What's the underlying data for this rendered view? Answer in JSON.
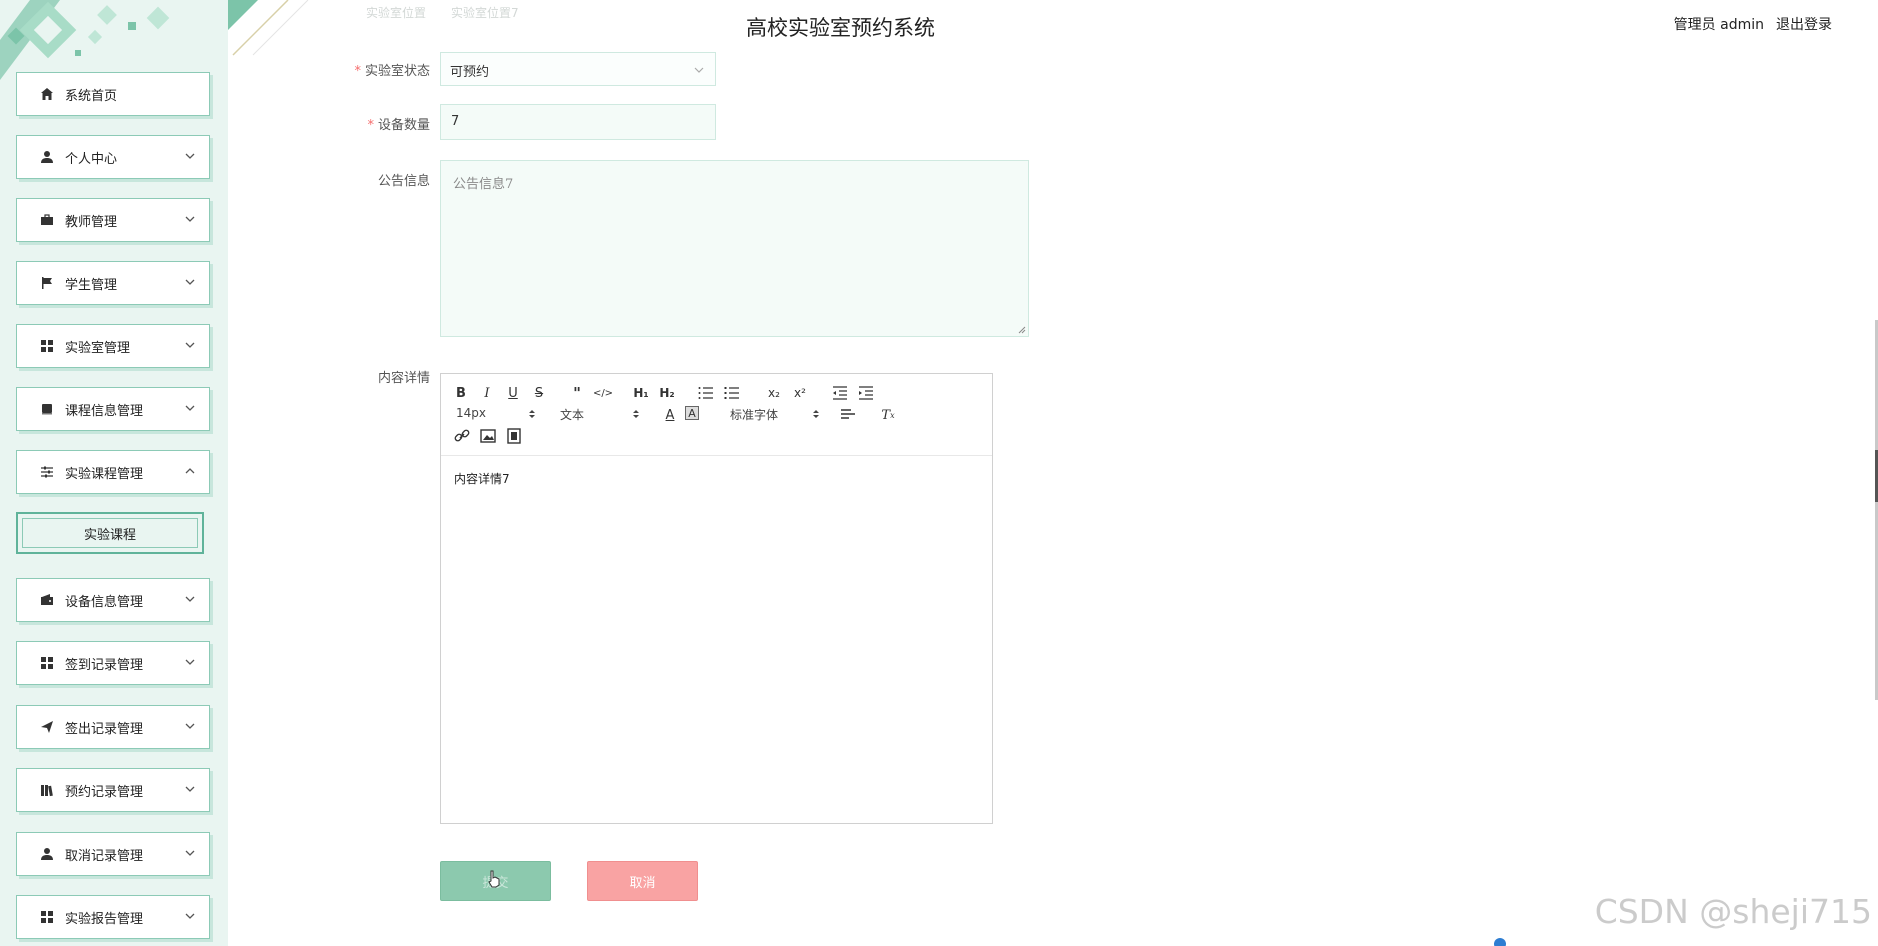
{
  "header": {
    "title": "高校实验室预约系统",
    "user_role": "管理员 admin",
    "logout": "退出登录"
  },
  "sidebar": {
    "items": [
      {
        "label": "系统首页",
        "icon": "home-icon"
      },
      {
        "label": "个人中心",
        "icon": "user-icon"
      },
      {
        "label": "教师管理",
        "icon": "briefcase-icon"
      },
      {
        "label": "学生管理",
        "icon": "flag-icon"
      },
      {
        "label": "实验室管理",
        "icon": "grid-icon"
      },
      {
        "label": "课程信息管理",
        "icon": "book-icon"
      },
      {
        "label": "实验课程管理",
        "icon": "sliders-icon"
      },
      {
        "label": "设备信息管理",
        "icon": "wallet-icon"
      },
      {
        "label": "签到记录管理",
        "icon": "grid-icon"
      },
      {
        "label": "签出记录管理",
        "icon": "send-icon"
      },
      {
        "label": "预约记录管理",
        "icon": "library-icon"
      },
      {
        "label": "取消记录管理",
        "icon": "user-icon"
      },
      {
        "label": "实验报告管理",
        "icon": "grid-icon"
      }
    ],
    "sub_item": "实验课程"
  },
  "form": {
    "faded_label": "实验室位置",
    "faded_value": "实验室位置7",
    "status_label": "实验室状态",
    "status_value": "可预约",
    "equip_label": "设备数量",
    "equip_value": "7",
    "notice_label": "公告信息",
    "notice_value": "公告信息7",
    "content_label": "内容详情",
    "content_value": "内容详情7"
  },
  "editor": {
    "font_size": "14px",
    "block_type": "文本",
    "font_family": "标准字体"
  },
  "buttons": {
    "submit": "提交",
    "cancel": "取消"
  },
  "watermark": "CSDN @sheji715",
  "colors": {
    "sidebar_bg": "#e9f5f1",
    "accent": "#8cc9ae",
    "cancel": "#f9a3a3"
  }
}
